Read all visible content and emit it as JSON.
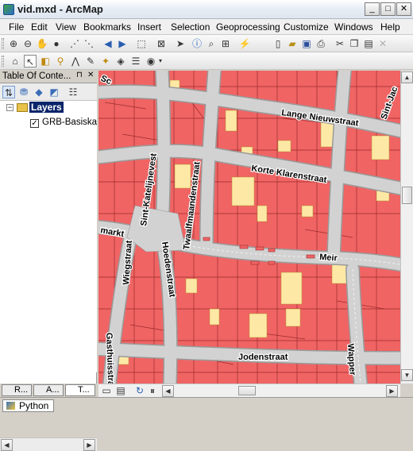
{
  "window": {
    "title": "vid.mxd - ArcMap",
    "minimize_glyph": "_",
    "maximize_glyph": "□",
    "close_glyph": "✕"
  },
  "menubar": {
    "items": [
      "File",
      "Edit",
      "View",
      "Bookmarks",
      "Insert",
      "Selection",
      "Geoprocessing",
      "Customize",
      "Windows",
      "Help"
    ]
  },
  "toolbar_row1": {
    "icons": [
      "zoom-in-icon",
      "zoom-out-icon",
      "pan-icon",
      "full-extent-icon",
      "fixed-zoom-in-icon",
      "fixed-zoom-out-icon",
      "back-icon",
      "forward-icon",
      "select-features-icon",
      "clear-selection-icon",
      "select-elements-icon",
      "identify-icon",
      "find-icon",
      "measure-icon",
      "hyperlink-icon",
      "new-icon",
      "open-icon",
      "save-icon",
      "print-icon",
      "cut-icon",
      "copy-icon",
      "paste-icon",
      "delete-icon"
    ]
  },
  "toolbar_row2": {
    "icons": [
      "home-icon",
      "draw-icon",
      "edit-vertices-icon",
      "pin-icon",
      "reshape-icon",
      "cut-polygon-icon",
      "split-icon",
      "rotate-icon",
      "attributes-icon",
      "sketch-properties-icon",
      "create-features-icon"
    ]
  },
  "toc": {
    "title": "Table Of Conte...",
    "pin_glyph": "⊓",
    "close_glyph": "✕",
    "root_label": "Layers",
    "layer_label": "GRB-Basiskaa",
    "layer_checked": true
  },
  "bottom_tabs": [
    "R...",
    "A...",
    "T..."
  ],
  "statusbar": {
    "python_label": "Python"
  },
  "map": {
    "streets": [
      "Lange Nieuwstraat",
      "Korte Klarenstraat",
      "Sint-Katelijnevest",
      "Twaalfmaandenstraat",
      "Hoedenstraat",
      "Wiegstraat",
      "Meir",
      "Jodenstraat",
      "Gasthuisstraat",
      "Wapper",
      "Sint-Jac",
      "markt",
      "Sc"
    ],
    "colors": {
      "building": "#f06464",
      "building_outline": "#9b2b2b",
      "yard": "#fde9a5",
      "street": "#d2d2d2",
      "street_edge": "#9a9a9a"
    }
  }
}
